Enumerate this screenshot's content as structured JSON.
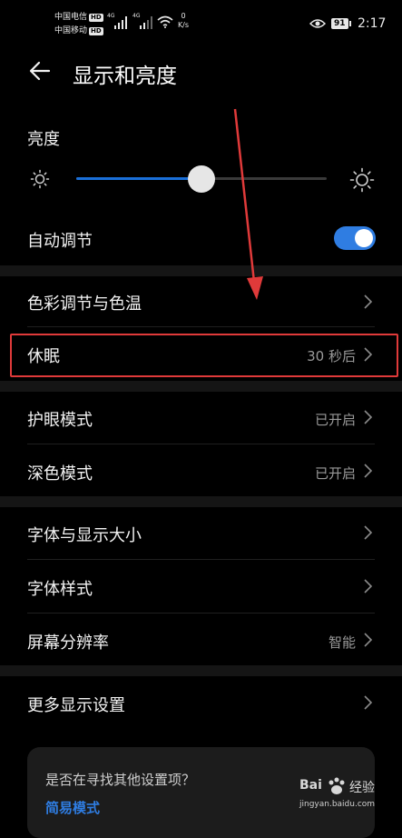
{
  "status_bar": {
    "carrier1": "中国电信",
    "carrier2": "中国移动",
    "hd_badge": "HD",
    "net1": "4G",
    "net2": "4G",
    "speed_value": "0",
    "speed_unit": "K/s",
    "battery": "91",
    "time": "2:17",
    "eye_icon": "eye-icon",
    "wifi_icon": "wifi-icon"
  },
  "header": {
    "back_icon": "arrow-left-icon",
    "title": "显示和亮度"
  },
  "brightness": {
    "label": "亮度",
    "level": 0.5,
    "min_icon": "sun-small-icon",
    "max_icon": "sun-large-icon"
  },
  "auto_adjust": {
    "label": "自动调节",
    "enabled": true
  },
  "rows": [
    {
      "label": "色彩调节与色温",
      "value": ""
    },
    {
      "label": "休眠",
      "value": "30 秒后"
    },
    {
      "label": "护眼模式",
      "value": "已开启"
    },
    {
      "label": "深色模式",
      "value": "已开启"
    },
    {
      "label": "字体与显示大小",
      "value": ""
    },
    {
      "label": "字体样式",
      "value": ""
    },
    {
      "label": "屏幕分辨率",
      "value": "智能"
    },
    {
      "label": "更多显示设置",
      "value": ""
    }
  ],
  "suggestion_card": {
    "question": "是否在寻找其他设置项？",
    "link": "简易模式"
  },
  "watermark": {
    "logo_left": "Bai",
    "logo_right": "经验",
    "url": "jingyan.baidu.com"
  },
  "colors": {
    "accent": "#2f7de2",
    "highlight": "#e03a3a",
    "background": "#000000"
  }
}
